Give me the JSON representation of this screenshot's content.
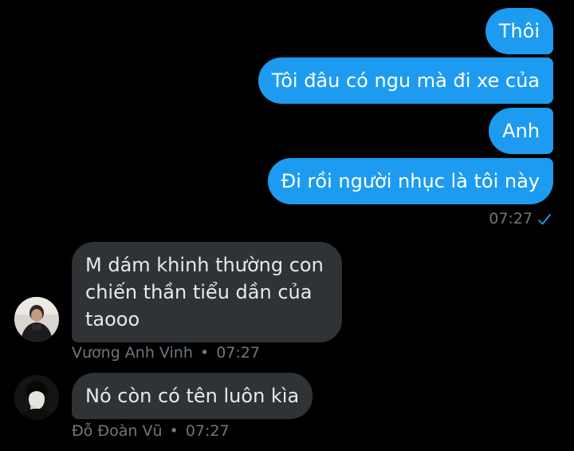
{
  "conversation": {
    "outgoing": [
      {
        "text": "Thôi"
      },
      {
        "text": "Tôi đâu có ngu mà đi xe của"
      },
      {
        "text": "Anh"
      },
      {
        "text": "Đi rồi người nhục là tôi này"
      }
    ],
    "outgoing_time": "07:27",
    "incoming": [
      {
        "text": "M dám khinh thường con chiến thần tiểu dần của taooo",
        "sender": "Vương Anh Vinh",
        "time": "07:27"
      },
      {
        "text": "Nó còn có tên luôn kìa",
        "sender": "Đỗ Đoàn Vũ",
        "time": "07:27"
      }
    ],
    "separator": "•"
  },
  "colors": {
    "background": "#000000",
    "outgoing_bubble": "#1d9bf0",
    "incoming_bubble": "#2f3336",
    "meta_text": "#71767b",
    "read_check": "#1d9bf0"
  },
  "icons": {
    "read_receipt": "check-icon",
    "avatar_1": "user-avatar",
    "avatar_2": "user-avatar"
  }
}
